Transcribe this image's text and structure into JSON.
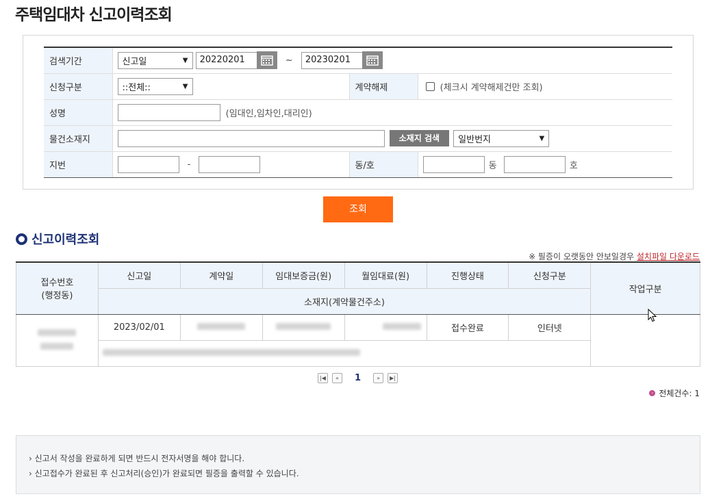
{
  "page": {
    "title": "주택임대차 신고이력조회"
  },
  "search": {
    "period_label": "검색기간",
    "period_type": "신고일",
    "date_from": "20220201",
    "date_sep": "~",
    "date_to": "20230201",
    "apply_type_label": "신청구분",
    "apply_type_value": "::전체::",
    "cancel_label": "계약해제",
    "cancel_hint": "(체크시 계약해제건만 조회)",
    "name_label": "성명",
    "name_hint": "(임대인,임차인,대리인)",
    "address_label": "물건소재지",
    "address_search_btn": "소재지 검색",
    "address_type": "일반번지",
    "lot_label": "지번",
    "lot_sep": "-",
    "dongho_label": "동/호",
    "dong_suffix": "동",
    "ho_suffix": "호",
    "search_button": "조회"
  },
  "results": {
    "section_title": "신고이력조회",
    "notice_text": "※ 필증이 오랫동안 안보일경우 ",
    "notice_link": "설치파일 다운로드",
    "headers": {
      "receipt_no": "접수번호",
      "receipt_sub": "(행정동)",
      "report_date": "신고일",
      "contract_date": "계약일",
      "deposit": "임대보증금(원)",
      "monthly": "월임대료(원)",
      "status": "진행상태",
      "apply_type": "신청구분",
      "work_type": "작업구분",
      "address": "소재지(계약물건주소)"
    },
    "rows": [
      {
        "report_date": "2023/02/01",
        "status": "접수완료",
        "apply_type": "인터넷"
      }
    ],
    "pager": {
      "current": "1"
    },
    "total_label": "전체건수: 1"
  },
  "info": {
    "lines": [
      "› 신고서 작성을 완료하게 되면 반드시 전자서명을 해야 합니다.",
      "› 신고접수가 완료된 후 신고처리(승인)가 완료되면 필증을 출력할 수 있습니다."
    ]
  },
  "colors": {
    "accent": "#ff6a13",
    "navy": "#1e3276",
    "header_bg": "#eef4fb"
  }
}
